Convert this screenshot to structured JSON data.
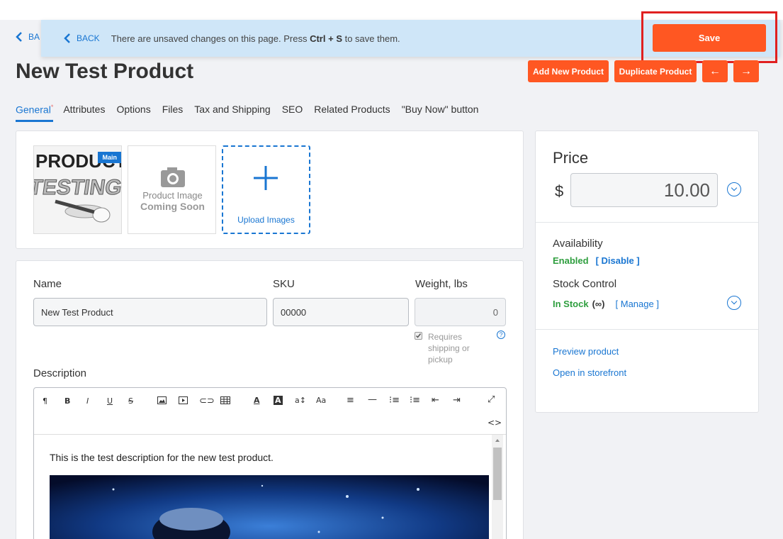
{
  "banner": {
    "back_label": "BACK",
    "message_pre": "There are unsaved changes on this page. Press ",
    "key1": "Ctrl",
    "plus": " + ",
    "key2": "S",
    "message_post": " to save them.",
    "save_label": "Save"
  },
  "under_back_label": "BA",
  "page_title": "New Test Product",
  "header_buttons": {
    "add_new": "Add New Product",
    "duplicate": "Duplicate Product",
    "prev": "←",
    "next": "→"
  },
  "tabs": [
    {
      "label": "General",
      "active": true,
      "marker": "*"
    },
    {
      "label": "Attributes"
    },
    {
      "label": "Options"
    },
    {
      "label": "Files"
    },
    {
      "label": "Tax and Shipping"
    },
    {
      "label": "SEO"
    },
    {
      "label": "Related Products"
    },
    {
      "label": "\"Buy Now\" button"
    }
  ],
  "images": {
    "main_badge": "Main",
    "thumb1_text1": "PRODUCT",
    "thumb1_text2": "TESTING",
    "placeholder_line1": "Product Image",
    "placeholder_line2": "Coming Soon",
    "upload_label": "Upload Images"
  },
  "form": {
    "name_label": "Name",
    "name_value": "New Test Product",
    "sku_label": "SKU",
    "sku_value": "00000",
    "weight_label": "Weight, lbs",
    "weight_value": "0",
    "requires_shipping": "Requires shipping or pickup",
    "help": "?",
    "description_label": "Description",
    "description_text": "This is the test description for the new test product."
  },
  "price_panel": {
    "price_title": "Price",
    "currency": "$",
    "price_value": "10.00",
    "availability_label": "Availability",
    "availability_status": "Enabled",
    "disable_link": "[ Disable ]",
    "stock_label": "Stock Control",
    "stock_status": "In Stock",
    "stock_qty": "(∞)",
    "manage_link": "[ Manage ]",
    "preview_link": "Preview product",
    "storefront_link": "Open in storefront"
  },
  "colors": {
    "accent": "#ff5722",
    "link": "#1976d2",
    "success": "#2e9e3e",
    "banner_bg": "#cfe6f8",
    "highlight": "#e02020"
  }
}
